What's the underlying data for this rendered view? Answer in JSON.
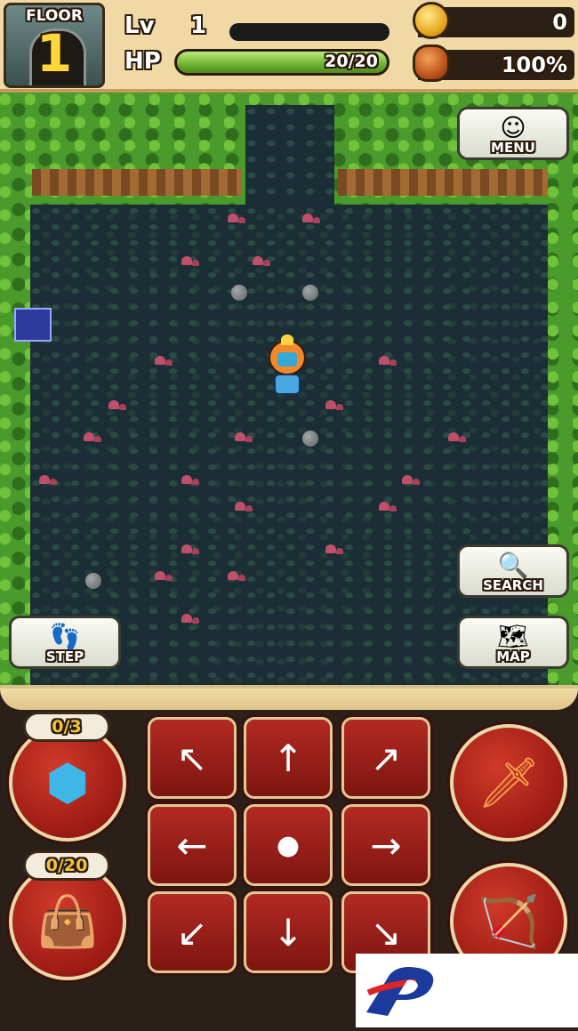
{
  "hud": {
    "floor_label": "FLOOR",
    "floor_number": "1",
    "level_label": "Lv",
    "level_value": "1",
    "hp_label": "HP",
    "hp_text": "20/20",
    "hp_fraction": 1.0,
    "xp_fraction": 0.0,
    "coins": "0",
    "food": "100%",
    "coin_icon": "coin-icon",
    "food_icon": "bread-icon"
  },
  "map_buttons": {
    "menu": "MENU",
    "search": "SEARCH",
    "map": "MAP",
    "step": "STEP"
  },
  "controls": {
    "pouch_count": "0/3",
    "bag_count": "0/20",
    "dpad": [
      "↖",
      "↑",
      "↗",
      "←",
      "●",
      "→",
      "↙",
      "↓",
      "↘"
    ],
    "attack_icon": "sword-icon",
    "bow_icon": "bow-icon"
  },
  "colors": {
    "hp_green": "#6fb234",
    "button_red": "#9c1b14",
    "hud_bg": "#f1d9a6",
    "floor_dark": "#1b2e35",
    "foliage": "#4a9a2c"
  }
}
